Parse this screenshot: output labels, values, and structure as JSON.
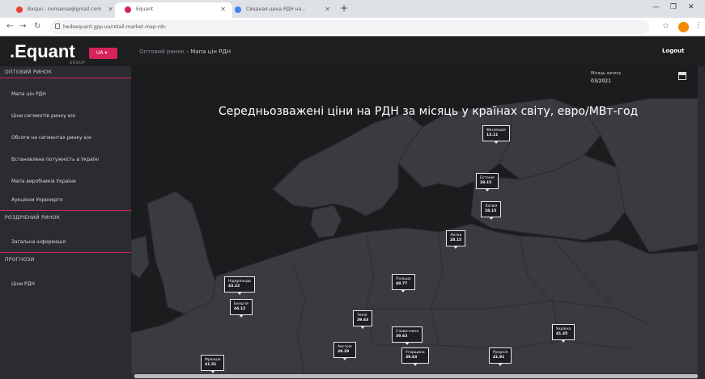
{
  "browser": {
    "tabs": [
      {
        "label": "Вхідні - nonsense@gmail.com",
        "icon": "gmail-icon"
      },
      {
        "label": "Equant",
        "icon": "equant-icon"
      },
      {
        "label": "Сводная цена РДН на...",
        "icon": "google-icon"
      }
    ],
    "url": "hedsequant.gpp.ua/retail-market-map-rdn",
    "colors": {
      "tab_bar": "#dee1e6",
      "profile": "#f28b00"
    }
  },
  "header": {
    "logo": ".Equant",
    "logo_sub": "GROUP",
    "lang_button": "UA",
    "breadcrumb_root": "Оптовий ринок",
    "breadcrumb_sep": " › ",
    "breadcrumb_current": "Мапа цін РДН",
    "logout": "Logout",
    "accent": "#d6245a"
  },
  "sidebar": {
    "section1": {
      "title": "ОПТОВИЙ РИНОК",
      "items": [
        "Мапа цін РДН",
        "Ціни сегментів ринку е/е",
        "Обсяги на сегментах ринку е/е",
        "Встановлена потужність в Україні",
        "Мапа виробників України",
        "Аукціони Укренерго"
      ]
    },
    "section2": {
      "title": "РОЗДРІБНИЙ РИНОК",
      "items": [
        "Загальна інформація"
      ]
    },
    "section3": {
      "title": "ПРОГНОЗИ",
      "items": [
        "Ціни РДН"
      ]
    }
  },
  "main": {
    "title": "Середньозважені ціни на РДН за місяць у країнах світу, евро/МВт-год",
    "date_label": "Місяць запису",
    "date_value": "03/2021",
    "calendar_icon": "calendar-icon"
  },
  "map": {
    "pins": [
      {
        "country": "Фінляндія",
        "value": "13.11"
      },
      {
        "country": "Естонія",
        "value": "28.15"
      },
      {
        "country": "Латвія",
        "value": "28.15"
      },
      {
        "country": "Литва",
        "value": "28.15"
      },
      {
        "country": "Польща",
        "value": "48.77"
      },
      {
        "country": "Нідерланди",
        "value": "43.22"
      },
      {
        "country": "Бельгія",
        "value": "44.12"
      },
      {
        "country": "Чехія",
        "value": "39.63"
      },
      {
        "country": "Словаччина",
        "value": "39.63"
      },
      {
        "country": "Австрія",
        "value": "39.29"
      },
      {
        "country": "Угорщина",
        "value": "39.63"
      },
      {
        "country": "Україна",
        "value": "41.45"
      },
      {
        "country": "Румунія",
        "value": "41.91"
      },
      {
        "country": "Франція",
        "value": "41.51"
      }
    ]
  }
}
